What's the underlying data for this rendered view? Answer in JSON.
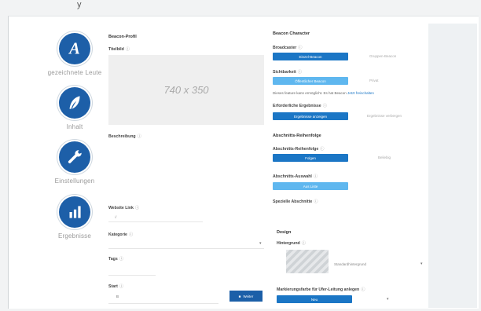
{
  "header": {
    "caption": "y"
  },
  "sidebar": {
    "items": [
      {
        "label": "gezeichnete Leute",
        "icon": "letter-a-icon"
      },
      {
        "label": "Inhalt",
        "icon": "feather-icon"
      },
      {
        "label": "Einstellungen",
        "icon": "wrench-icon"
      },
      {
        "label": "Ergebnisse",
        "icon": "bar-chart-icon"
      }
    ]
  },
  "profile": {
    "title": "Beacon-Profil",
    "title_image_label": "Titelbild",
    "image_placeholder": "740 x 350",
    "description_label": "Beschreibung",
    "website_label": "Website Link",
    "website_value": "//",
    "category_label": "Kategorie",
    "tags_label": "Tags",
    "start_label": "Start",
    "start_value": "B",
    "save_label": "Weiter"
  },
  "character": {
    "title": "Beacon Character",
    "broadcast_label": "Broadcaster",
    "broadcast_active": "Einzel-Beacon",
    "broadcast_alt": "Gruppen-Beacon",
    "visibility_label": "Sichtbarkeit",
    "visibility_active": "Öffentlicher Beacon",
    "visibility_alt": "Privat",
    "visibility_hint": "Dieses feature kann ermöglicht. Es hat Beacon",
    "visibility_link": "Jetzt freischalten",
    "reach_label": "Erforderliche Ergebnisse",
    "reach_active": "Ergebnisse anzeigen",
    "reach_alt": "Ergebnisse verbergen"
  },
  "sequence": {
    "title": "Abschnitts-Reihenfolge",
    "order_label": "Abschnitts-Reihenfolge",
    "order_active": "Folgen",
    "order_alt": "Beliebig",
    "select_label": "Abschnitts-Auswahl",
    "select_active": "Aus Liste",
    "special_label": "Spezielle Abschnitte"
  },
  "design": {
    "title": "Design",
    "background_label": "Hintergrund",
    "background_value": "Standardhintergrund",
    "bar_label": "Markierungsfarbe für Ufer-Leitung anlegen",
    "bar_button": "Neu"
  }
}
